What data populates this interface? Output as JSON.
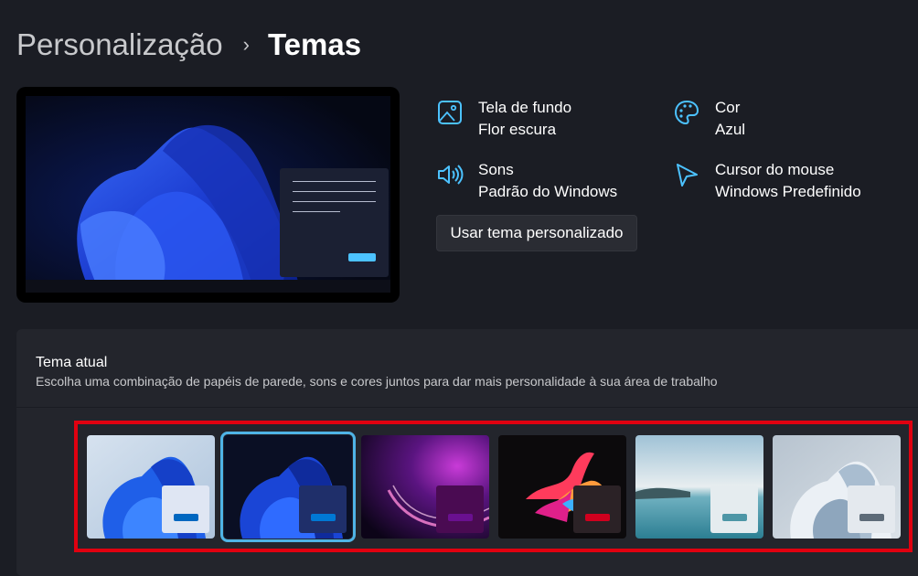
{
  "breadcrumb": {
    "parent": "Personalização",
    "separator": "›",
    "current": "Temas"
  },
  "properties": {
    "wallpaper": {
      "label": "Tela de fundo",
      "value": "Flor escura"
    },
    "color": {
      "label": "Cor",
      "value": "Azul"
    },
    "sounds": {
      "label": "Sons",
      "value": "Padrão do Windows"
    },
    "cursor": {
      "label": "Cursor do mouse",
      "value": "Windows Predefinido"
    }
  },
  "custom_theme_button": "Usar tema personalizado",
  "current_theme": {
    "title": "Tema atual",
    "subtitle": "Escolha uma combinação de papéis de parede, sons e cores juntos para dar mais personalidade à sua área de trabalho"
  },
  "themes": [
    {
      "name": "windows-light",
      "selected": false,
      "swatch_bg": "#dfe6f3",
      "accent": "#0067c0"
    },
    {
      "name": "windows-dark",
      "selected": true,
      "swatch_bg": "#1f2f6a",
      "accent": "#0078d4"
    },
    {
      "name": "glow",
      "selected": false,
      "swatch_bg": "#4a0b52",
      "accent": "#6a1090"
    },
    {
      "name": "captured-motion",
      "selected": false,
      "swatch_bg": "#2b2226",
      "accent": "#d0001e"
    },
    {
      "name": "sunrise",
      "selected": false,
      "swatch_bg": "#e5ecef",
      "accent": "#4d96a6"
    },
    {
      "name": "flow",
      "selected": false,
      "swatch_bg": "#e4e9ee",
      "accent": "#5d6b78"
    }
  ],
  "accent_color": "#4cc2ff",
  "highlight_color": "#e00010"
}
